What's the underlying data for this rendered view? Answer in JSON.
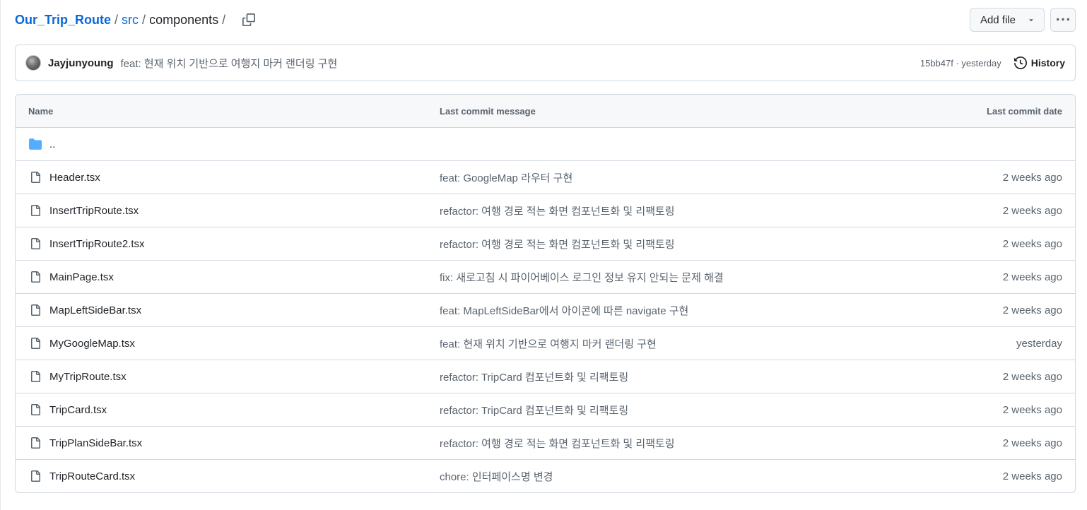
{
  "breadcrumb": {
    "repo": "Our_Trip_Route",
    "sep1": "/",
    "dir": "src",
    "sep2": "/",
    "current": "components",
    "sep3": "/"
  },
  "icons": {
    "copy": "copy-icon",
    "caret": "triangle-down-icon",
    "more": "kebab-horizontal-icon",
    "history": "history-icon",
    "folder": "folder-icon",
    "file": "file-icon"
  },
  "actions": {
    "add_file": "Add file"
  },
  "latest_commit": {
    "author": "Jayjunyoung",
    "message": "feat: 현재 위치 기반으로 여행지 마커 랜더링 구현",
    "meta": "15bb47f · yesterday",
    "history": "History"
  },
  "table": {
    "headers": {
      "name": "Name",
      "message": "Last commit message",
      "date": "Last commit date"
    },
    "parent": "..",
    "rows": [
      {
        "name": "Header.tsx",
        "message": "feat: GoogleMap 라우터 구현",
        "date": "2 weeks ago"
      },
      {
        "name": "InsertTripRoute.tsx",
        "message": "refactor: 여행 경로 적는 화면 컴포넌트화 및 리팩토링",
        "date": "2 weeks ago"
      },
      {
        "name": "InsertTripRoute2.tsx",
        "message": "refactor: 여행 경로 적는 화면 컴포넌트화 및 리팩토링",
        "date": "2 weeks ago"
      },
      {
        "name": "MainPage.tsx",
        "message": "fix: 새로고침 시 파이어베이스 로그인 정보 유지 안되는 문제 해결",
        "date": "2 weeks ago"
      },
      {
        "name": "MapLeftSideBar.tsx",
        "message": "feat: MapLeftSideBar에서 아이콘에 따른 navigate 구현",
        "date": "2 weeks ago"
      },
      {
        "name": "MyGoogleMap.tsx",
        "message": "feat: 현재 위치 기반으로 여행지 마커 랜더링 구현",
        "date": "yesterday"
      },
      {
        "name": "MyTripRoute.tsx",
        "message": "refactor: TripCard 컴포넌트화 및 리팩토링",
        "date": "2 weeks ago"
      },
      {
        "name": "TripCard.tsx",
        "message": "refactor: TripCard 컴포넌트화 및 리팩토링",
        "date": "2 weeks ago"
      },
      {
        "name": "TripPlanSideBar.tsx",
        "message": "refactor: 여행 경로 적는 화면 컴포넌트화 및 리팩토링",
        "date": "2 weeks ago"
      },
      {
        "name": "TripRouteCard.tsx",
        "message": "chore: 인터페이스명 변경",
        "date": "2 weeks ago"
      }
    ]
  }
}
